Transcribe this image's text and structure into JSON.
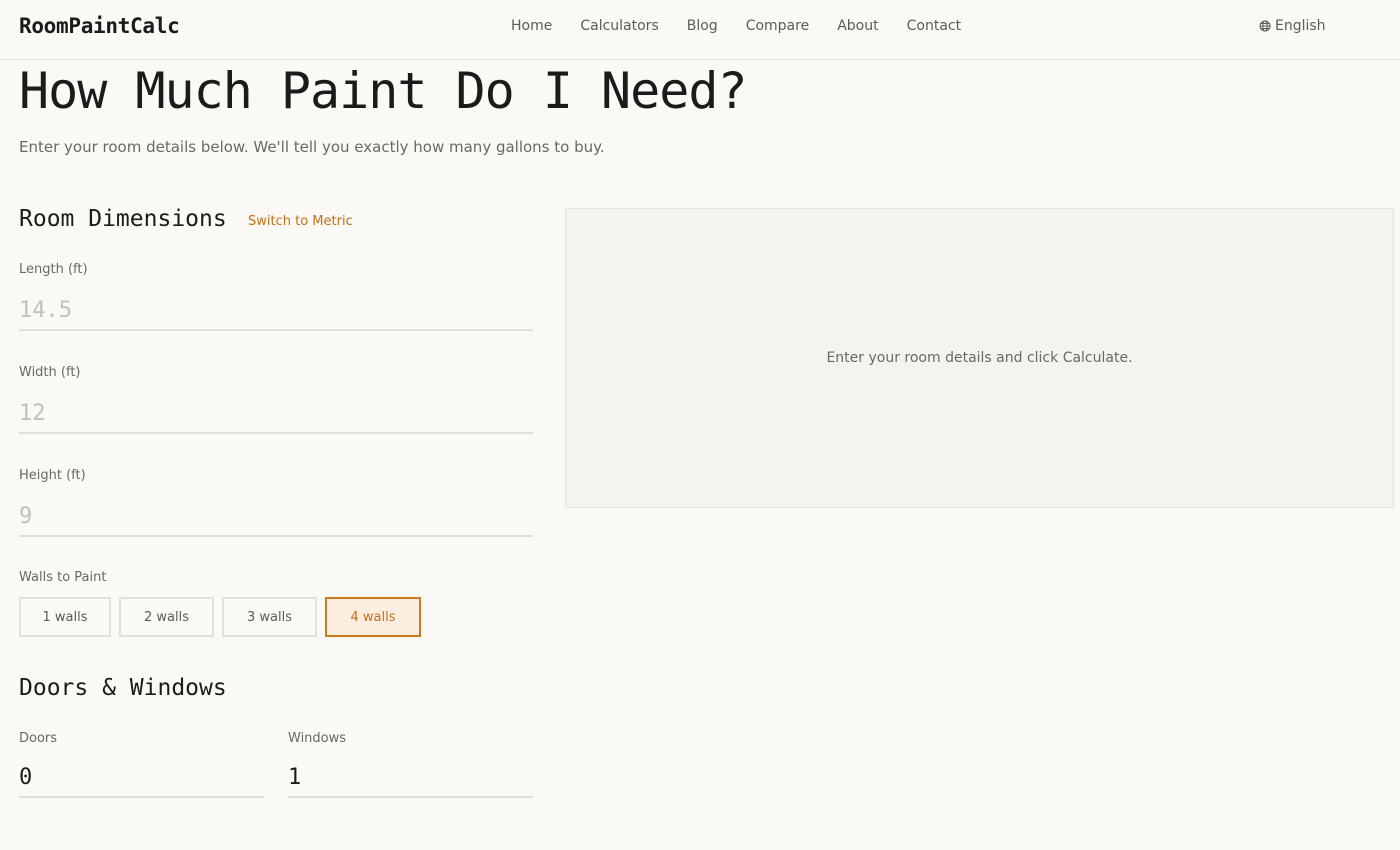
{
  "header": {
    "brand": "RoomPaintCalc",
    "nav": [
      "Home",
      "Calculators",
      "Blog",
      "Compare",
      "About",
      "Contact"
    ],
    "language": "English"
  },
  "page": {
    "title": "How Much Paint Do I Need?",
    "subtitle": "Enter your room details below. We'll tell you exactly how many gallons to buy."
  },
  "dimensions": {
    "title": "Room Dimensions",
    "switch_label": "Switch to Metric",
    "length": {
      "label": "Length (ft)",
      "placeholder": "14.5"
    },
    "width": {
      "label": "Width (ft)",
      "placeholder": "12"
    },
    "height": {
      "label": "Height (ft)",
      "placeholder": "9"
    }
  },
  "walls": {
    "label": "Walls to Paint",
    "options": [
      "1 walls",
      "2 walls",
      "3 walls",
      "4 walls"
    ],
    "selected": "4 walls"
  },
  "openings": {
    "title": "Doors & Windows",
    "doors": {
      "label": "Doors",
      "value": "0"
    },
    "windows": {
      "label": "Windows",
      "value": "1"
    }
  },
  "results": {
    "message": "Enter your room details and click Calculate."
  },
  "colors": {
    "accent": "#c46f17",
    "accent_bg": "#fbeee0",
    "background": "#faf9f6"
  }
}
